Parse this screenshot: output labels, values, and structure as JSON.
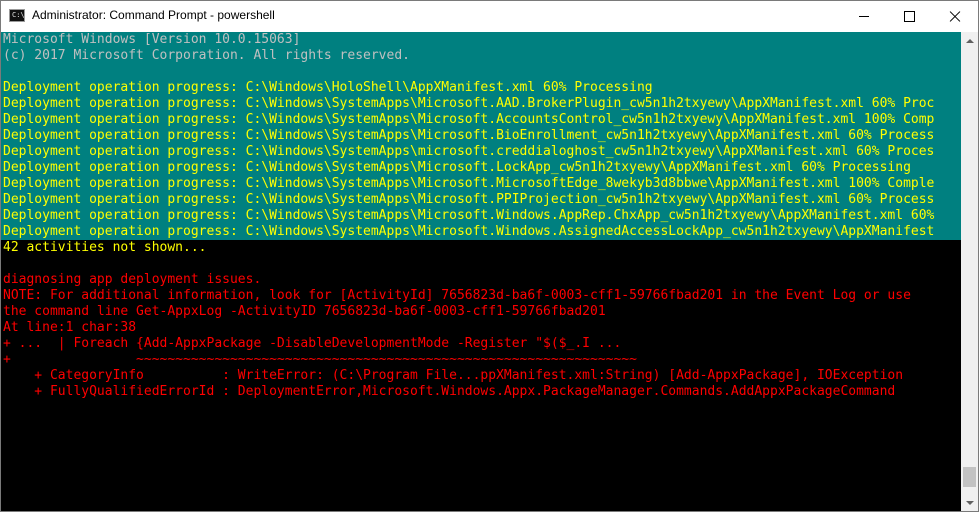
{
  "window": {
    "title": "Administrator: Command Prompt - powershell",
    "app_icon_text": "C:\\",
    "icons": [
      "cmd-icon",
      "minimize-icon",
      "maximize-icon",
      "close-icon",
      "scroll-up-icon",
      "scroll-down-icon"
    ]
  },
  "console": {
    "header": [
      "Microsoft Windows [Version 10.0.15063]",
      "(c) 2017 Microsoft Corporation. All rights reserved."
    ],
    "progress": [
      "Deployment operation progress: C:\\Windows\\HoloShell\\AppXManifest.xml 60% Processing",
      "Deployment operation progress: C:\\Windows\\SystemApps\\Microsoft.AAD.BrokerPlugin_cw5n1h2txyewy\\AppXManifest.xml 60% Proc",
      "Deployment operation progress: C:\\Windows\\SystemApps\\Microsoft.AccountsControl_cw5n1h2txyewy\\AppXManifest.xml 100% Comp",
      "Deployment operation progress: C:\\Windows\\SystemApps\\Microsoft.BioEnrollment_cw5n1h2txyewy\\AppXManifest.xml 60% Process",
      "Deployment operation progress: C:\\Windows\\SystemApps\\microsoft.creddialoghost_cw5n1h2txyewy\\AppXManifest.xml 60% Proces",
      "Deployment operation progress: C:\\Windows\\SystemApps\\Microsoft.LockApp_cw5n1h2txyewy\\AppXManifest.xml 60% Processing",
      "Deployment operation progress: C:\\Windows\\SystemApps\\Microsoft.MicrosoftEdge_8wekyb3d8bbwe\\AppXManifest.xml 100% Comple",
      "Deployment operation progress: C:\\Windows\\SystemApps\\Microsoft.PPIProjection_cw5n1h2txyewy\\AppXManifest.xml 60% Process",
      "Deployment operation progress: C:\\Windows\\SystemApps\\Microsoft.Windows.AppRep.ChxApp_cw5n1h2txyewy\\AppXManifest.xml 60%",
      "Deployment operation progress: C:\\Windows\\SystemApps\\Microsoft.Windows.AssignedAccessLockApp_cw5n1h2txyewy\\AppXManifest",
      "42 activities not shown..."
    ],
    "errors": [
      "diagnosing app deployment issues.",
      "NOTE: For additional information, look for [ActivityId] 7656823d-ba6f-0003-cff1-59766fbad201 in the Event Log or use",
      "the command line Get-AppxLog -ActivityID 7656823d-ba6f-0003-cff1-59766fbad201",
      "At line:1 char:38",
      "+ ...  | Foreach {Add-AppxPackage -DisableDevelopmentMode -Register \"$($_.I ...",
      "+                ~~~~~~~~~~~~~~~~~~~~~~~~~~~~~~~~~~~~~~~~~~~~~~~~~~~~~~~~~~~~~~~~",
      "    + CategoryInfo          : WriteError: (C:\\Program File...ppXManifest.xml:String) [Add-AppxPackage], IOException",
      "    + FullyQualifiedErrorId : DeploymentError,Microsoft.Windows.Appx.PackageManager.Commands.AddAppxPackageCommand"
    ]
  },
  "colors": {
    "console_background": "#000000",
    "progress_background": "#008080",
    "progress_text": "#ffff00",
    "error_text": "#ff0000",
    "normal_text": "#c0c0c0"
  }
}
